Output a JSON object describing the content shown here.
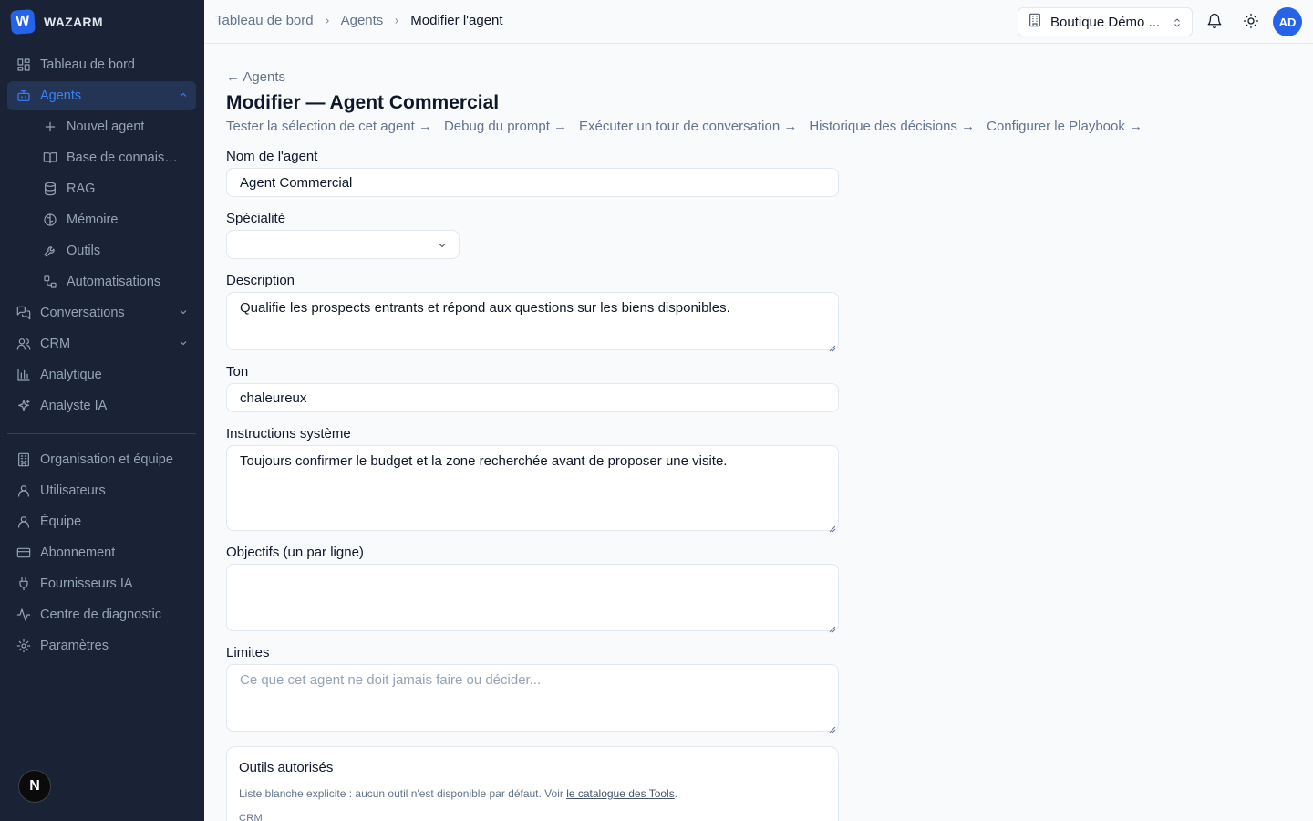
{
  "brand": {
    "logo_letter": "W",
    "name": "WAZARM"
  },
  "sidebar": {
    "items": [
      {
        "label": "Tableau de bord",
        "icon": "dashboard-icon"
      },
      {
        "label": "Agents",
        "icon": "bot-icon",
        "active": true
      },
      {
        "label": "Conversations",
        "icon": "chat-icon"
      },
      {
        "label": "CRM",
        "icon": "users-icon"
      },
      {
        "label": "Analytique",
        "icon": "chart-icon"
      },
      {
        "label": "Analyste IA",
        "icon": "sparkles-icon"
      }
    ],
    "agents_sub": [
      {
        "label": "Nouvel agent",
        "icon": "plus-icon"
      },
      {
        "label": "Base de connaissances",
        "icon": "book-icon"
      },
      {
        "label": "RAG",
        "icon": "database-icon"
      },
      {
        "label": "Mémoire",
        "icon": "brain-icon"
      },
      {
        "label": "Outils",
        "icon": "wrench-icon"
      },
      {
        "label": "Automatisations",
        "icon": "workflow-icon"
      }
    ],
    "admin": [
      {
        "label": "Organisation et équipe",
        "icon": "building-icon"
      },
      {
        "label": "Utilisateurs",
        "icon": "user-icon"
      },
      {
        "label": "Équipe",
        "icon": "user-icon"
      },
      {
        "label": "Abonnement",
        "icon": "credit-card-icon"
      },
      {
        "label": "Fournisseurs IA",
        "icon": "plug-icon"
      },
      {
        "label": "Centre de diagnostic",
        "icon": "activity-icon"
      },
      {
        "label": "Paramètres",
        "icon": "settings-icon"
      }
    ],
    "footer_badge": "N"
  },
  "topbar": {
    "breadcrumb": [
      "Tableau de bord",
      "Agents",
      "Modifier l'agent"
    ],
    "org_selector": "Boutique Démo ...",
    "avatar_initials": "AD"
  },
  "page": {
    "back_link": "← Agents",
    "title": "Modifier — Agent Commercial",
    "quick_links": [
      "Tester la sélection de cet agent →",
      "Debug du prompt →",
      "Exécuter un tour de conversation →",
      "Historique des décisions →",
      "Configurer le Playbook →"
    ]
  },
  "form": {
    "name_label": "Nom de l'agent",
    "name_value": "Agent Commercial",
    "specialty_label": "Spécialité",
    "specialty_value": "",
    "description_label": "Description",
    "description_value": "Qualifie les prospects entrants et répond aux questions sur les biens disponibles.",
    "tone_label": "Ton",
    "tone_value": "chaleureux",
    "instructions_label": "Instructions système",
    "instructions_value": "Toujours confirmer le budget et la zone recherchée avant de proposer une visite.",
    "objectives_label": "Objectifs (un par ligne)",
    "objectives_value": "",
    "limits_label": "Limites",
    "limits_placeholder": "Ce que cet agent ne doit jamais faire ou décider..."
  },
  "tools": {
    "title": "Outils autorisés",
    "help_prefix": "Liste blanche explicite : aucun outil n'est disponible par défaut. Voir ",
    "help_link": "le catalogue des Tools",
    "help_suffix": ".",
    "group_crm": "CRM"
  }
}
